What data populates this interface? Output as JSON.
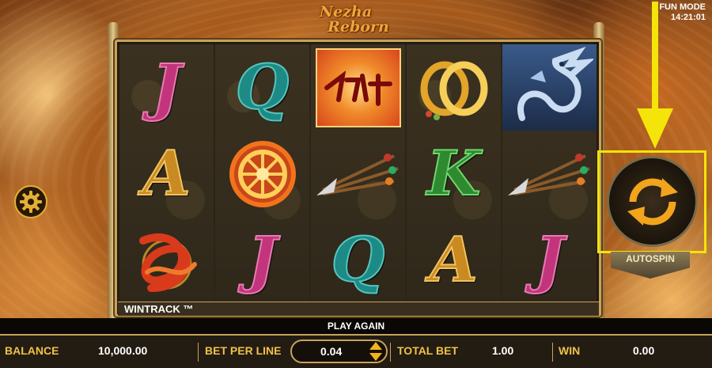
{
  "header": {
    "logo_line1": "Nezha",
    "logo_line2": "Reborn",
    "mode": "FUN MODE",
    "clock": "14:21:01"
  },
  "reels": [
    [
      {
        "type": "letter",
        "glyph": "J",
        "icon": "j-symbol"
      },
      {
        "type": "letter",
        "glyph": "A",
        "icon": "a-symbol"
      },
      {
        "type": "image",
        "icon": "red-knot-symbol"
      }
    ],
    [
      {
        "type": "letter",
        "glyph": "Q",
        "icon": "q-symbol"
      },
      {
        "type": "image",
        "icon": "fire-wheel-symbol"
      },
      {
        "type": "letter",
        "glyph": "J",
        "icon": "j-symbol"
      }
    ],
    [
      {
        "type": "scatter",
        "icon": "scatter-symbol"
      },
      {
        "type": "image",
        "icon": "spear-symbol"
      },
      {
        "type": "letter",
        "glyph": "Q",
        "icon": "q-symbol"
      }
    ],
    [
      {
        "type": "image",
        "icon": "gold-rings-symbol"
      },
      {
        "type": "letter",
        "glyph": "K",
        "icon": "k-symbol"
      },
      {
        "type": "letter",
        "glyph": "A",
        "icon": "a-symbol"
      }
    ],
    [
      {
        "type": "image",
        "icon": "dragon-symbol"
      },
      {
        "type": "image",
        "icon": "spear-symbol"
      },
      {
        "type": "letter",
        "glyph": "J",
        "icon": "j-symbol"
      }
    ]
  ],
  "wintrack": "WINTRACK ™",
  "autospin_label": "AUTOSPIN",
  "play_again": "PLAY AGAIN",
  "footer": {
    "balance_label": "BALANCE",
    "balance_value": "10,000.00",
    "bet_per_line_label": "BET PER LINE",
    "bet_per_line_value": "0.04",
    "total_bet_label": "TOTAL BET",
    "total_bet_value": "1.00",
    "win_label": "WIN",
    "win_value": "0.00"
  },
  "colors": {
    "highlight": "#f4e409",
    "gold": "#c9a25a",
    "label_gold": "#f0c24a"
  },
  "icons": {
    "settings": "gear-icon",
    "autospin": "refresh-icon",
    "pointer": "arrow-down-icon",
    "bet_up": "triangle-up-icon",
    "bet_down": "triangle-down-icon"
  }
}
